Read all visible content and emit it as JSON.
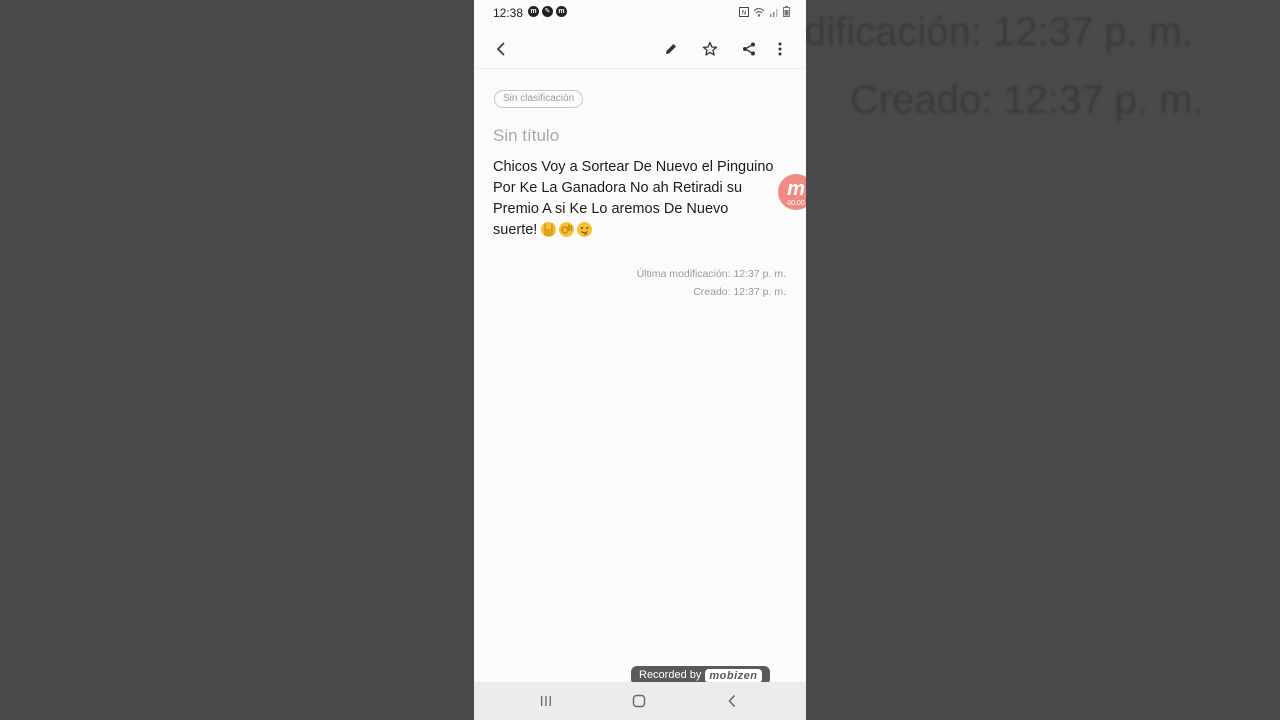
{
  "background": {
    "modified_text": "dificación: 12:37 p. m.",
    "created_text": "Creado: 12:37 p. m."
  },
  "status_bar": {
    "time": "12:38",
    "app_icons": [
      "mobizen-icon",
      "app-icon",
      "mobizen-icon"
    ],
    "system_icons": [
      "nfc-icon",
      "wifi-icon",
      "signal-icon",
      "battery-icon"
    ]
  },
  "toolbar": {
    "icons": [
      "back-arrow-icon",
      "pencil-icon",
      "star-icon",
      "share-icon",
      "more-vert-icon"
    ]
  },
  "note": {
    "category": "Sin clasificación",
    "title": "Sin título",
    "body": "Chicos Voy a  Sortear De Nuevo el Pinguino Por Ke La Ganadora No ah Retiradi su Premio A si Ke Lo aremos De Nuevo suerte!",
    "emojis": [
      "rock-on-hand-emoji",
      "ok-hand-emoji",
      "winking-tongue-face-emoji"
    ],
    "last_modified": "Última modificación: 12:37 p. m.",
    "created": "Creado: 12:37 p. m."
  },
  "recorder": {
    "bubble_letter": "m",
    "bubble_timer": "00:00",
    "badge_text": "Recorded by",
    "badge_brand": "mobizen"
  },
  "nav_bar": {
    "icons": [
      "recent-apps-icon",
      "home-icon",
      "nav-back-icon"
    ]
  },
  "colors": {
    "page_bg": "#4a4a4a",
    "note_bg": "#fbfbfb",
    "text": "#1c1c1c",
    "muted": "#9a9a9a",
    "mobizen_accent": "#f08b84"
  }
}
